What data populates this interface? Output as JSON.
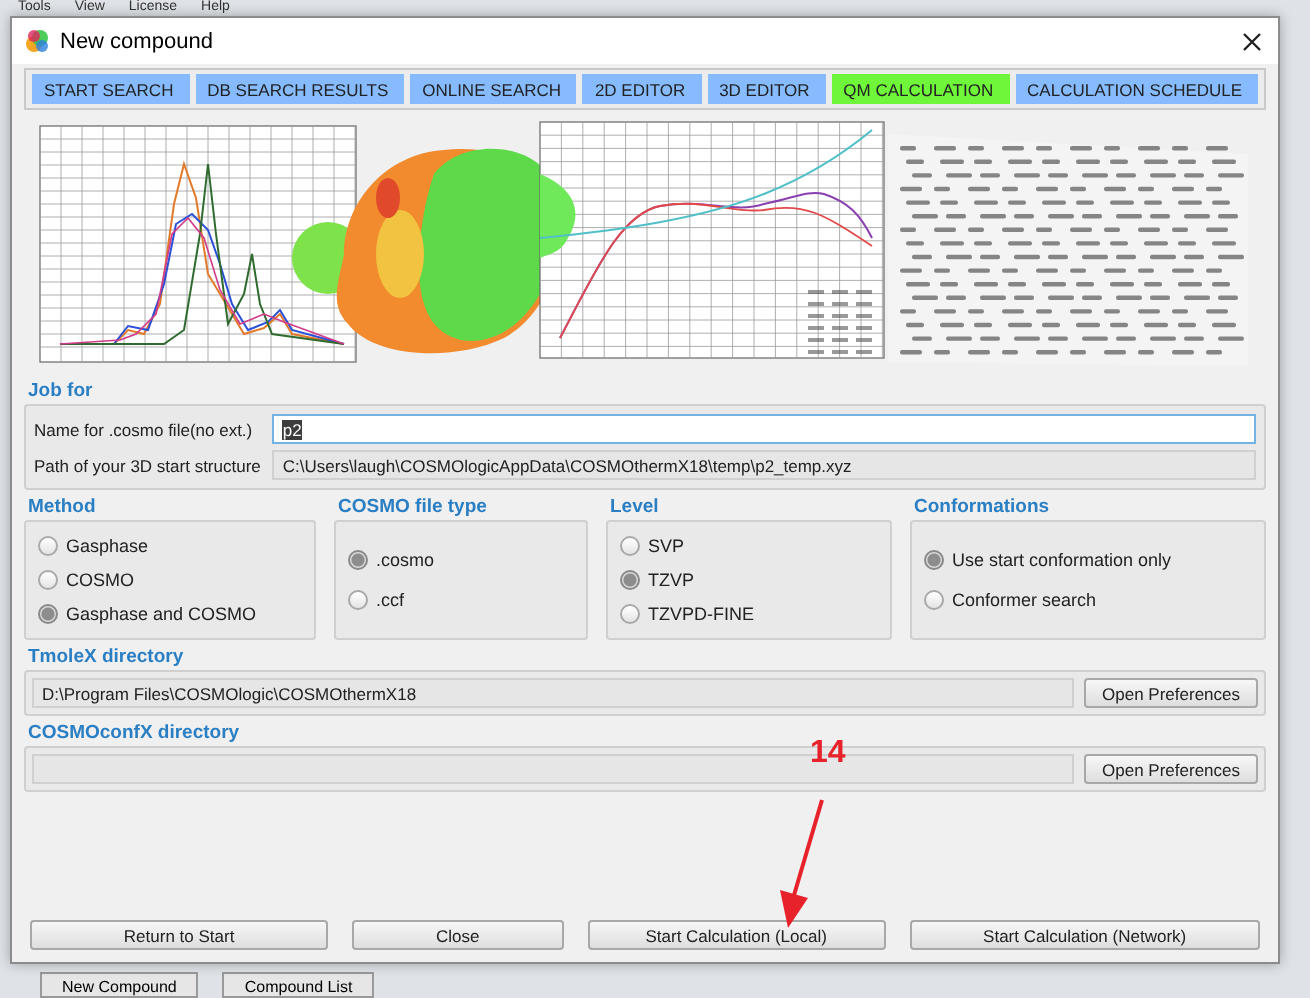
{
  "background_app": {
    "menu": [
      "Tools",
      "View",
      "License",
      "Help"
    ],
    "buttons": [
      "New Compound",
      "Compound List"
    ]
  },
  "window": {
    "title": "New compound"
  },
  "tabs": [
    {
      "label": "START SEARCH",
      "selected": false
    },
    {
      "label": "DB SEARCH RESULTS",
      "selected": false
    },
    {
      "label": "ONLINE SEARCH",
      "selected": false
    },
    {
      "label": "2D EDITOR",
      "selected": false
    },
    {
      "label": "3D EDITOR",
      "selected": false
    },
    {
      "label": "QM CALCULATION",
      "selected": true
    },
    {
      "label": "CALCULATION SCHEDULE",
      "selected": false
    }
  ],
  "job_for": {
    "title": "Job for",
    "fields": [
      {
        "label": "Name for .cosmo file(no ext.)",
        "value": "p2",
        "readonly": false
      },
      {
        "label": "Path of your 3D start structure",
        "value": "C:\\Users\\laugh\\COSMOlogicAppData\\COSMOthermX18\\temp\\p2_temp.xyz",
        "readonly": true
      }
    ]
  },
  "option_groups": [
    {
      "title": "Method",
      "options": [
        {
          "label": "Gasphase",
          "selected": false
        },
        {
          "label": "COSMO",
          "selected": false
        },
        {
          "label": "Gasphase and COSMO",
          "selected": true
        }
      ]
    },
    {
      "title": "COSMO file type",
      "options": [
        {
          "label": ".cosmo",
          "selected": true
        },
        {
          "label": ".ccf",
          "selected": false
        }
      ]
    },
    {
      "title": "Level",
      "options": [
        {
          "label": "SVP",
          "selected": false
        },
        {
          "label": "TZVP",
          "selected": true
        },
        {
          "label": "TZVPD-FINE",
          "selected": false
        }
      ]
    },
    {
      "title": "Conformations",
      "options": [
        {
          "label": "Use start conformation only",
          "selected": true
        },
        {
          "label": "Conformer search",
          "selected": false
        }
      ]
    }
  ],
  "directories": [
    {
      "title": "TmoleX directory",
      "value": "D:\\Program Files\\COSMOlogic\\COSMOthermX18",
      "button": "Open Preferences"
    },
    {
      "title": "COSMOconfX directory",
      "button": "Open Preferences"
    }
  ],
  "annotation": {
    "label": "14"
  },
  "buttons": [
    "Return to Start",
    "Close",
    "Start Calculation (Local)",
    "Start Calculation (Network)"
  ]
}
